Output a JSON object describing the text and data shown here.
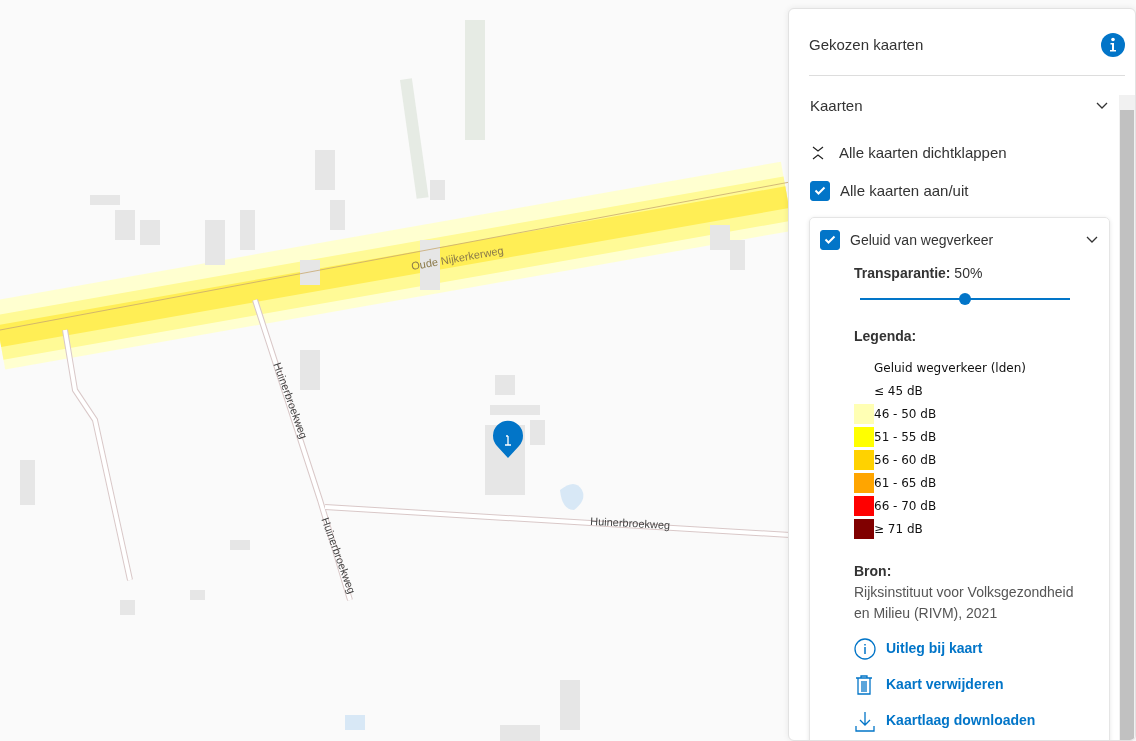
{
  "map": {
    "labels": [
      {
        "text": "Oude Nijkerkerweg",
        "kind": "road"
      },
      {
        "text": "Huinerbroekweg",
        "kind": "road"
      },
      {
        "text": "Huinerbroekweg",
        "kind": "road"
      },
      {
        "text": "Huinerbroekweg",
        "kind": "road"
      }
    ]
  },
  "panel": {
    "title": "Gekozen kaarten",
    "section": {
      "title": "Kaarten",
      "expanded": true
    },
    "collapse_all": "Alle kaarten dichtklappen",
    "toggle_all": {
      "label": "Alle kaarten aan/uit",
      "checked": true
    },
    "layers": [
      {
        "title": "Geluid van wegverkeer",
        "checked": true,
        "expanded": true,
        "transparency": {
          "label": "**Transparantie:** 50%",
          "level": 0.5
        },
        "legend_title": "Legenda:",
        "legend": [
          {
            "text": "Geluid wegverkeer (lden)"
          },
          {
            "text": "≤ 45 dB"
          },
          {
            "text": "46 - 50 dB",
            "color": "#ffffb4"
          },
          {
            "text": "51 - 55 dB",
            "color": "#ffff00"
          },
          {
            "text": "56 - 60 dB",
            "color": "#ffd200"
          },
          {
            "text": "61 - 65 dB",
            "color": "#ffa500"
          },
          {
            "text": "66 - 70 dB",
            "color": "#ff0000"
          },
          {
            "text": "≥ 71 dB",
            "color": "#800000"
          }
        ],
        "source_title": "Bron:",
        "source": "Rijksinstituut voor Volksgezondheid en Milieu (RIVM), 2021",
        "links": [
          {
            "kind": "info",
            "text": "Uitleg bij kaart"
          },
          {
            "kind": "trash",
            "text": "Kaart verwijderen"
          },
          {
            "kind": "download",
            "text": "Kaartlaag downloaden"
          }
        ]
      }
    ]
  }
}
